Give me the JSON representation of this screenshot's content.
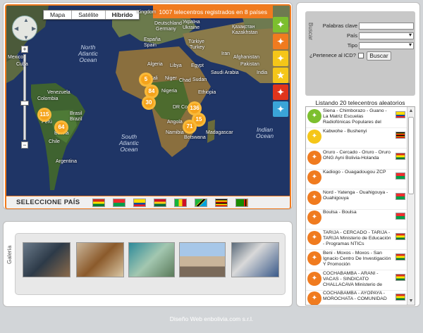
{
  "map": {
    "type_buttons": [
      "Mapa",
      "Satélite",
      "Híbrido"
    ],
    "banner": "1007 telecentros registrados en 8 países",
    "clusters": [
      "5",
      "84",
      "30",
      "115",
      "64",
      "136",
      "15",
      "71"
    ],
    "oceans": [
      {
        "text": "North\nAtlantic\nOcean"
      },
      {
        "text": "South\nAtlantic\nOcean"
      },
      {
        "text": "Indian\nOcean"
      }
    ],
    "labels": [
      "Kingdom",
      "Deutschland",
      "Germany",
      "Україна",
      "Ukraine",
      "Қазақстан",
      "Kazakhstan",
      "Türkiye",
      "Turkey",
      "España",
      "Spain",
      "Algeria",
      "Libya",
      "Egypt",
      "Iran",
      "Pakistan",
      "Mali",
      "Niger",
      "Chad",
      "Sudan",
      "Saudi Arabia",
      "Nigeria",
      "Ethiopia",
      "DR Congo",
      "Angola",
      "Namibia",
      "Botswana",
      "Madagascar",
      "Venezuela",
      "Colombia",
      "Brasil",
      "Brazil",
      "Perú",
      "Bolivia",
      "Chile",
      "Argentina",
      "Cuba",
      "Mexico",
      "India",
      "Afghanistan"
    ],
    "country_bar_title": "SELECCIONE PAÍS",
    "flags": [
      "bolivia",
      "burkina-faso",
      "ecuador",
      "ghana",
      "mali",
      "tanzania",
      "uganda",
      "zambia"
    ]
  },
  "gallery": {
    "label": "Galería",
    "thumbnails": [
      "computer-users",
      "classroom",
      "workshop",
      "building",
      "training"
    ]
  },
  "search": {
    "label": "Buscar",
    "fields": [
      {
        "label": "Palabras clave",
        "type": "text",
        "value": ""
      },
      {
        "label": "País",
        "type": "select",
        "value": ""
      },
      {
        "label": "Tipo",
        "type": "select",
        "value": ""
      }
    ],
    "icd_question": "¿Pertenece al ICD?",
    "button": "Buscar"
  },
  "list": {
    "title": "Listando 20 telecentros aleatorios",
    "items": [
      {
        "text": "Siena - Chimborazo - Guano - La Matriz Escuelas Radiofónicas Populares del",
        "flag": "ecuador",
        "color": "#7cbf2e"
      },
      {
        "text": "Kabwohe - Bushenyi",
        "flag": "uganda",
        "color": "#f5c618"
      },
      {
        "text": "Oruro - Cercado - Oruro - Oruro ONG Ayni Bolivia-Holanda",
        "flag": "bolivia",
        "color": "#f07b1f"
      },
      {
        "text": "Kadiogo - Ouagadougou ZCP",
        "flag": "burkina-faso",
        "color": "#f07b1f"
      },
      {
        "text": "Nord - Yatenga - Ouahigouya - Ouahigouya",
        "flag": "burkina-faso",
        "color": "#f07b1f"
      },
      {
        "text": "Boulsa - Boulsa",
        "flag": "burkina-faso",
        "color": "#f07b1f"
      },
      {
        "text": "TARIJA - CERCADO - TARIJA - TARIJA Ministerio de Educación - Programas NTICs",
        "flag": "bolivia",
        "color": "#f07b1f"
      },
      {
        "text": "Beni - Moxos - Moxos - San Ignacio Centro De Investigación Y Promoción",
        "flag": "bolivia",
        "color": "#f07b1f"
      },
      {
        "text": "COCHABAMBA - ARANI - VACAS - SINDICATO CHALLACAVA Ministerio de",
        "flag": "bolivia",
        "color": "#f07b1f"
      },
      {
        "text": "COCHABAMBA - AYOPAYA - MOROCHATA - COMUNIDAD",
        "flag": "bolivia",
        "color": "#f07b1f"
      }
    ]
  },
  "footer": "Diseño Web enbolivia.com s.r.l.",
  "colors": {
    "accent": "#f07b1f",
    "ocean": "#1f3a6b",
    "land": "#5a6e3c"
  }
}
